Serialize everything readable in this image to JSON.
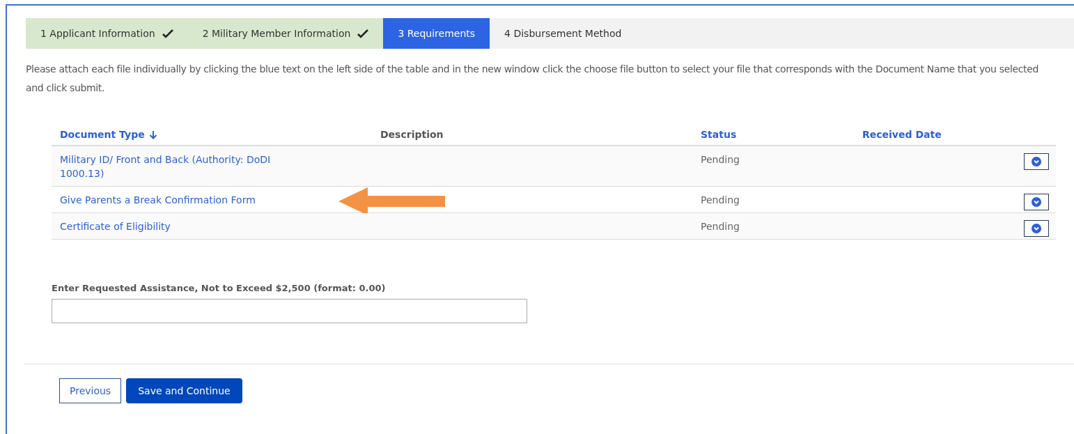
{
  "steps": [
    {
      "label": "1 Applicant Information",
      "completed": true,
      "selected": false
    },
    {
      "label": "2 Military Member Information",
      "completed": true,
      "selected": false
    },
    {
      "label": "3 Requirements",
      "completed": false,
      "selected": true
    },
    {
      "label": "4 Disbursement Method",
      "completed": false,
      "selected": false
    }
  ],
  "instructions": "Please attach each file individually by clicking the blue text on the left side of the table and in the new window click the choose file button to select your file that corresponds with the Document Name that you selected and click submit.",
  "table": {
    "columns": [
      {
        "label": "Document Type",
        "sortable": true,
        "sorted": true
      },
      {
        "label": "Description",
        "sortable": false,
        "sorted": false
      },
      {
        "label": "Status",
        "sortable": true,
        "sorted": false
      },
      {
        "label": "Received Date",
        "sortable": true,
        "sorted": false
      }
    ],
    "rows": [
      {
        "document_type": "Military ID/ Front and Back (Authority: DoDI 1000.13)",
        "status": "Pending"
      },
      {
        "document_type": "Give Parents a Break Confirmation Form",
        "status": "Pending",
        "highlighted": true
      },
      {
        "document_type": "Certificate of Eligibility",
        "status": "Pending"
      }
    ]
  },
  "assistance": {
    "label": "Enter Requested Assistance, Not to Exceed $2,500 (format: 0.00)"
  },
  "buttons": [
    {
      "label": "Previous",
      "kind": "secondary"
    },
    {
      "label": "Save and Continue",
      "kind": "primary"
    }
  ]
}
